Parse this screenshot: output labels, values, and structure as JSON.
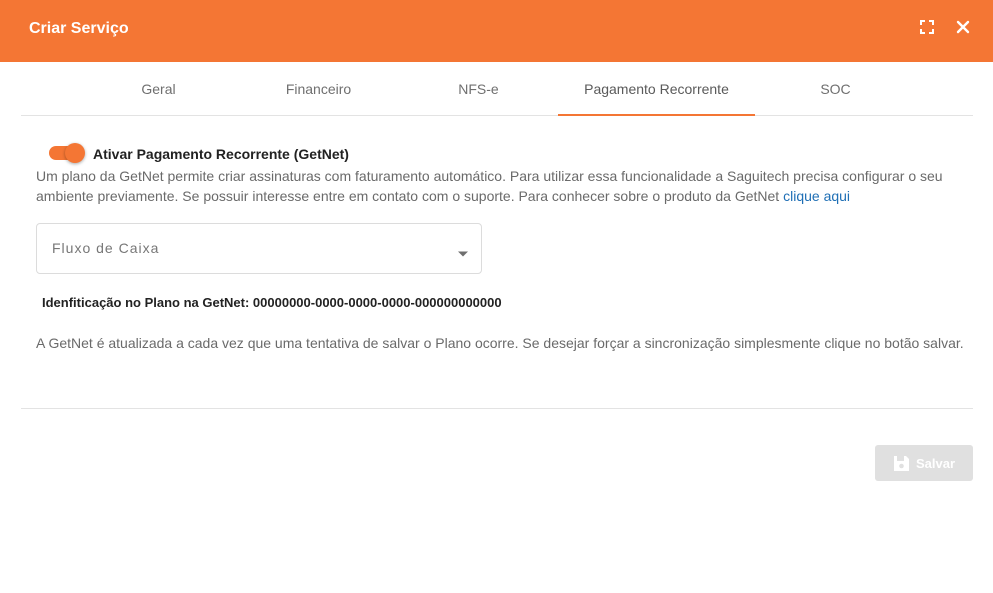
{
  "header": {
    "title": "Criar Serviço",
    "expand_icon": "expand-icon",
    "close_icon": "close-icon"
  },
  "tabs": [
    {
      "label": "Geral",
      "active": false
    },
    {
      "label": "Financeiro",
      "active": false
    },
    {
      "label": "NFS-e",
      "active": false
    },
    {
      "label": "Pagamento Recorrente",
      "active": true
    },
    {
      "label": "SOC",
      "active": false
    }
  ],
  "recurring": {
    "toggle_on": true,
    "toggle_label": "Ativar Pagamento Recorrente (GetNet)",
    "description": "Um plano da GetNet permite criar assinaturas com faturamento automático. Para utilizar essa funcionalidade a Saguitech precisa configurar o seu ambiente previamente. Se possuir interesse entre em contato com o suporte. Para conhecer sobre o produto da GetNet ",
    "link_text": "clique aqui"
  },
  "select": {
    "value": "Fluxo de Caixa"
  },
  "identification": {
    "text": "Idenfiticação no Plano na GetNet: 00000000-0000-0000-0000-000000000000"
  },
  "info": {
    "text": "A GetNet é atualizada a cada vez que uma tentativa de salvar o Plano ocorre. Se desejar forçar a sincronização simplesmente clique no botão salvar."
  },
  "actions": {
    "save_label": "Salvar",
    "save_enabled": false
  },
  "colors": {
    "accent": "#f47634",
    "link": "#1f6fb5",
    "disabled_button": "#e0e0e0"
  }
}
